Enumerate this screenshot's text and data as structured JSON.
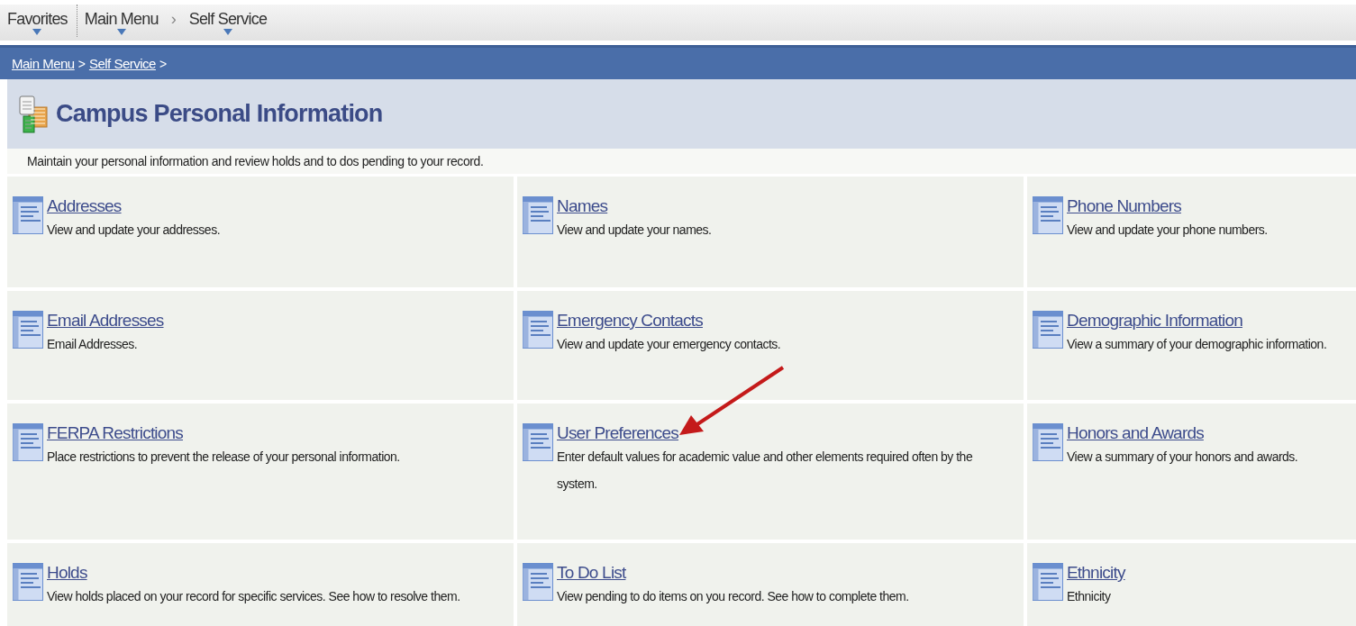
{
  "nav": {
    "entries": [
      {
        "kind": "menu",
        "label": "Favorites"
      },
      {
        "kind": "divider"
      },
      {
        "kind": "menu",
        "label": "Main Menu"
      },
      {
        "kind": "chevron",
        "label": "›"
      },
      {
        "kind": "menu",
        "label": "Self Service"
      }
    ]
  },
  "breadcrumb": [
    {
      "kind": "link",
      "text": "Main Menu"
    },
    {
      "kind": "text",
      "text": ">"
    },
    {
      "kind": "link",
      "text": "Self Service"
    },
    {
      "kind": "text",
      "text": ">"
    }
  ],
  "page": {
    "title": "Campus Personal Information",
    "description": "Maintain your personal information and review holds and to dos pending to your record."
  },
  "tiles": [
    {
      "title": "Addresses",
      "description": "View and update your addresses."
    },
    {
      "title": "Names",
      "description": "View and update your names."
    },
    {
      "title": "Phone Numbers",
      "description": "View and update your phone numbers."
    },
    {
      "title": "Email Addresses",
      "description": "Email Addresses."
    },
    {
      "title": "Emergency Contacts",
      "description": "View and update your emergency contacts."
    },
    {
      "title": "Demographic Information",
      "description": "View a summary of your demographic information."
    },
    {
      "title": "FERPA Restrictions",
      "description": "Place restrictions to prevent the release of your personal information."
    },
    {
      "title": "User Preferences",
      "description": "Enter default values for academic value and other elements required often by the system.",
      "annotated": true
    },
    {
      "title": "Honors and Awards",
      "description": "View a summary of your honors and awards."
    },
    {
      "title": "Holds",
      "description": "View holds placed on your record for specific services. See how to resolve them."
    },
    {
      "title": "To Do List",
      "description": "View pending to do items on you record. See how to complete them."
    },
    {
      "title": "Ethnicity",
      "description": "Ethnicity"
    }
  ]
}
